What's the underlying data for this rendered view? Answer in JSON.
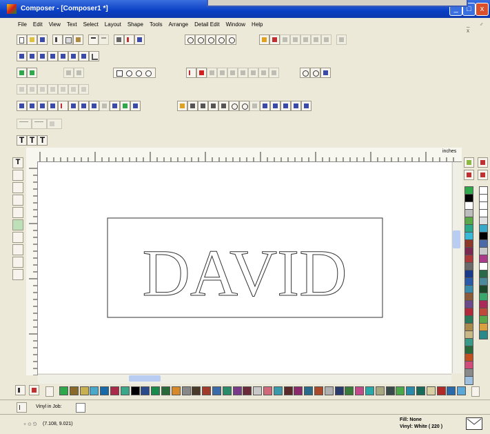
{
  "window": {
    "title": "Composer - [Composer1 *]",
    "minimize_glyph": "_",
    "maximize_glyph": "□",
    "close_glyph": "x"
  },
  "menu": {
    "items": [
      "File",
      "Edit",
      "View",
      "Text",
      "Select",
      "Layout",
      "Shape",
      "Tools",
      "Arrange",
      "Detail Edit",
      "Window",
      "Help"
    ],
    "mdi_controls": "_ ♂ x"
  },
  "ruler": {
    "unit_label": "inches"
  },
  "canvas": {
    "text": "DAVID"
  },
  "bottom_bar": {
    "vinyl_in_job_label": "Vinyl in Job:"
  },
  "status": {
    "coordinates": "(7.108, 9.021)",
    "fill": "Fill: None",
    "vinyl": "Vinyl: White ( 220 )"
  },
  "colors": {
    "title_bar": "#0a3fc4",
    "vertical_palette": [
      "#2ea84a",
      "#000000",
      "#ffffff",
      "#bdbdbd",
      "#5aa84a",
      "#2aa88a",
      "#3ab8d8",
      "#8b3a2a",
      "#7a2a50",
      "#aa3a3a",
      "#6a6a6a",
      "#1a3a8a",
      "#2a5aa8",
      "#3a8aaa",
      "#8a5a3a",
      "#6a4a8a",
      "#b02a3a",
      "#2a7a5a",
      "#aa8a4a",
      "#c8b888",
      "#3a9a8a",
      "#2a6a3a",
      "#c05020",
      "#d04a7a",
      "#8a8a8a",
      "#a0c0e0"
    ],
    "vertical_palette_right": [
      "#ffffff",
      "#ffffff",
      "#ffffff",
      "#ffffff",
      "#e0e0e0",
      "#3aa8c8",
      "#000000",
      "#4a6aa8",
      "#c8c8c8",
      "#aa3a8a",
      "#ffffff",
      "#2a6a4a",
      "#4a8a9a",
      "#1a4a2a",
      "#3aa86a",
      "#aa2a5a",
      "#c04a3a",
      "#5aa84a",
      "#d8a040",
      "#2a8a8a"
    ],
    "horizontal_palette": [
      "#2ea84a",
      "#8a6a2a",
      "#c8b050",
      "#4aa8c8",
      "#1a6aa8",
      "#aa2a4a",
      "#3aa888",
      "#000000",
      "#2a4a8a",
      "#1a8a4a",
      "#2a6a3a",
      "#d88a2a",
      "#888888",
      "#4a3a2a",
      "#a03a2a",
      "#3a6aa8",
      "#2a8a6a",
      "#7a3a8a",
      "#6a2a3a",
      "#c8c8c8",
      "#d06a7a",
      "#3a9aaa",
      "#5a2a2a",
      "#8a2a6a",
      "#2a6a8a",
      "#aa4a2a",
      "#b0b0b0",
      "#2a3a6a",
      "#3a7a3a",
      "#c04a8a",
      "#2aa8a8",
      "#a8a880",
      "#3a4a4a",
      "#4aa84a",
      "#2a8aaa",
      "#1a6a5a",
      "#d8d0a0",
      "#b02a2a",
      "#2a6aa8",
      "#5aa8d8"
    ]
  }
}
